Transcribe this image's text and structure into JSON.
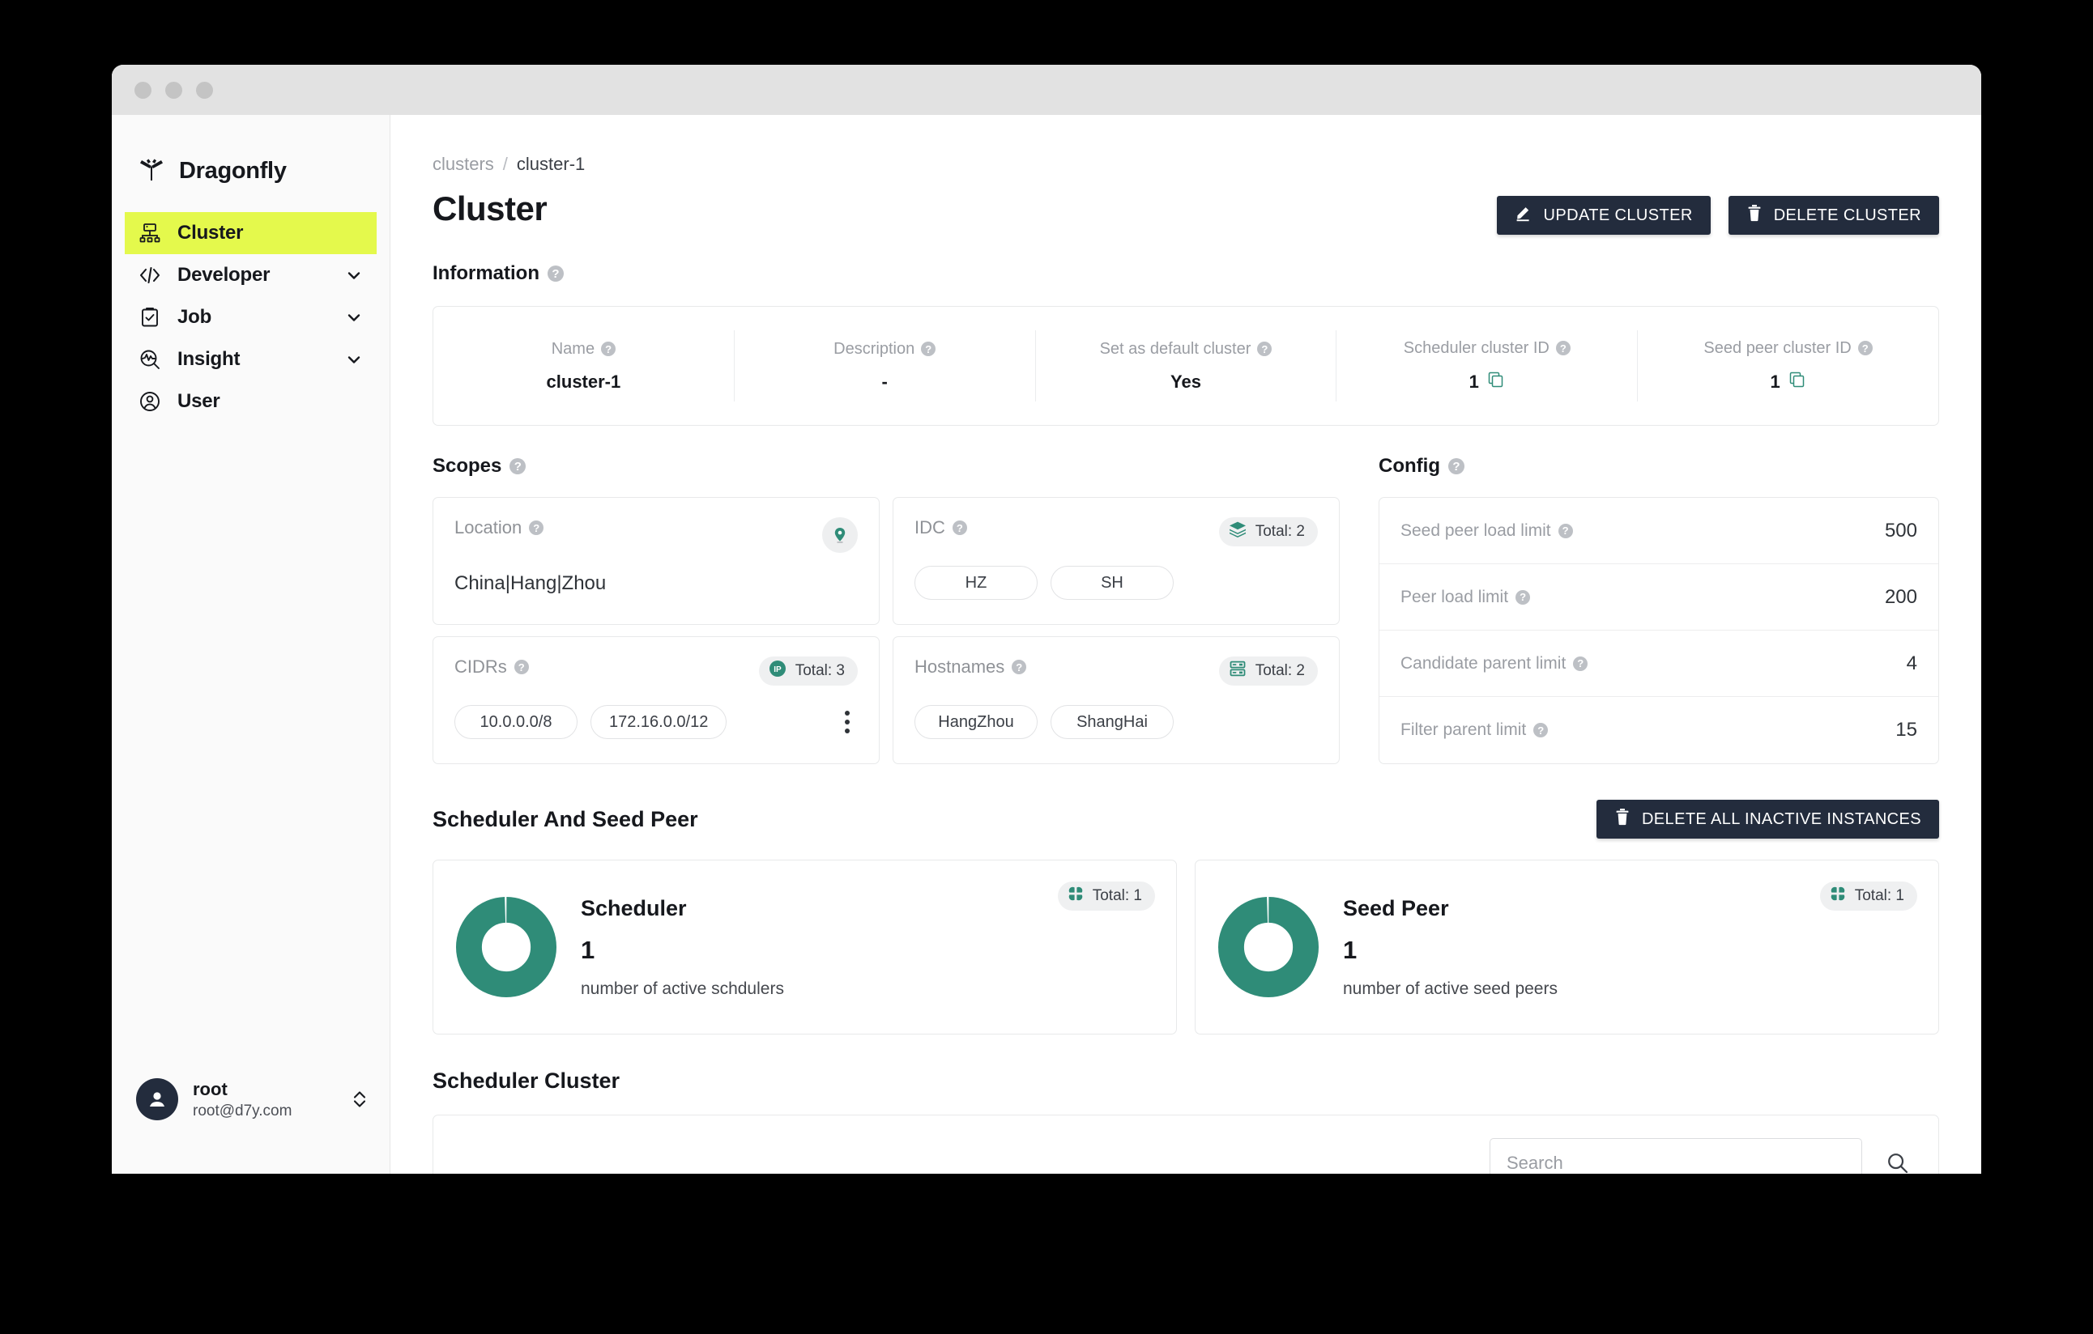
{
  "window": {
    "dots": [
      "close",
      "minimize",
      "maximize"
    ]
  },
  "brand": {
    "name": "Dragonfly",
    "logo_icon": "dragonfly-logo-icon",
    "accent": "#E4F94C"
  },
  "sidebar": {
    "items": [
      {
        "label": "Cluster",
        "icon": "cluster-icon",
        "active": true,
        "expandable": false
      },
      {
        "label": "Developer",
        "icon": "code-icon",
        "active": false,
        "expandable": true
      },
      {
        "label": "Job",
        "icon": "clipboard-check-icon",
        "active": false,
        "expandable": true
      },
      {
        "label": "Insight",
        "icon": "insight-search-icon",
        "active": false,
        "expandable": true
      },
      {
        "label": "User",
        "icon": "user-circle-icon",
        "active": false,
        "expandable": false
      }
    ],
    "user": {
      "name": "root",
      "email": "root@d7y.com",
      "avatar_icon": "avatar-icon",
      "switch_icon": "chevron-up-down-icon"
    }
  },
  "breadcrumb": {
    "parent": "clusters",
    "separator": "/",
    "current": "cluster-1"
  },
  "page": {
    "title": "Cluster"
  },
  "toolbar": {
    "update_label": "UPDATE CLUSTER",
    "update_icon": "pencil-icon",
    "delete_label": "DELETE CLUSTER",
    "delete_icon": "trash-icon"
  },
  "information": {
    "heading": "Information",
    "help_icon": "help-icon",
    "cells": [
      {
        "label": "Name",
        "value": "cluster-1",
        "copy": false
      },
      {
        "label": "Description",
        "value": "-",
        "copy": false
      },
      {
        "label": "Set as default cluster",
        "value": "Yes",
        "copy": false
      },
      {
        "label": "Scheduler cluster ID",
        "value": "1",
        "copy": true,
        "copy_icon": "copy-icon"
      },
      {
        "label": "Seed peer cluster ID",
        "value": "1",
        "copy": true,
        "copy_icon": "copy-icon"
      }
    ]
  },
  "scopes": {
    "heading": "Scopes",
    "location": {
      "label": "Location",
      "value": "China|Hang|Zhou",
      "icon": "location-pin-icon"
    },
    "cidrs": {
      "label": "CIDRs",
      "total_text": "Total: 3",
      "badge_icon": "ip-icon",
      "chips": [
        "10.0.0.0/8",
        "172.16.0.0/12"
      ],
      "more_icon": "more-vertical-icon"
    },
    "idc": {
      "label": "IDC",
      "total_text": "Total: 2",
      "badge_icon": "layers-icon",
      "chips": [
        "HZ",
        "SH"
      ]
    },
    "hostnames": {
      "label": "Hostnames",
      "total_text": "Total: 2",
      "badge_icon": "server-rack-icon",
      "chips": [
        "HangZhou",
        "ShangHai"
      ]
    }
  },
  "config": {
    "heading": "Config",
    "rows": [
      {
        "label": "Seed peer load limit",
        "value": "500"
      },
      {
        "label": "Peer load limit",
        "value": "200"
      },
      {
        "label": "Candidate parent limit",
        "value": "4"
      },
      {
        "label": "Filter parent limit",
        "value": "15"
      }
    ]
  },
  "scheduler_seed_peer": {
    "heading": "Scheduler And Seed Peer",
    "delete_inactive_label": "DELETE ALL INACTIVE INSTANCES",
    "delete_inactive_icon": "trash-icon",
    "cards": [
      {
        "title": "Scheduler",
        "count": "1",
        "desc": "number of active schdulers",
        "total_text": "Total: 1",
        "badge_icon": "clover-icon"
      },
      {
        "title": "Seed Peer",
        "count": "1",
        "desc": "number of active seed peers",
        "total_text": "Total: 1",
        "badge_icon": "clover-icon"
      }
    ],
    "donut_color": "#2F8C78",
    "donut_percent": 100
  },
  "scheduler_cluster": {
    "heading": "Scheduler Cluster",
    "search_placeholder": "Search",
    "search_value": "",
    "search_icon": "search-icon"
  },
  "chart_data": [
    {
      "type": "pie",
      "title": "Scheduler",
      "labels": [
        "active schedulers"
      ],
      "values": [
        1
      ],
      "total": 1,
      "colors": [
        "#2F8C78"
      ],
      "donut": true
    },
    {
      "type": "pie",
      "title": "Seed Peer",
      "labels": [
        "active seed peers"
      ],
      "values": [
        1
      ],
      "total": 1,
      "colors": [
        "#2F8C78"
      ],
      "donut": true
    }
  ]
}
